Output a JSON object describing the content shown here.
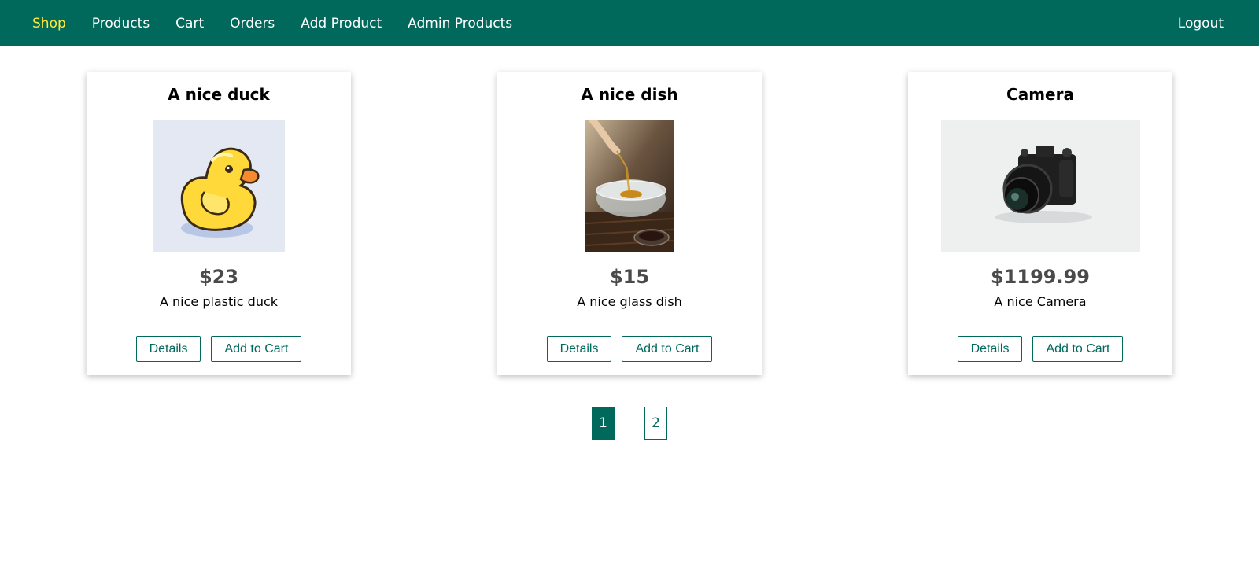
{
  "nav": {
    "items": [
      "Shop",
      "Products",
      "Cart",
      "Orders",
      "Add Product",
      "Admin Products"
    ],
    "active": "Shop",
    "logout": "Logout"
  },
  "products": [
    {
      "title": "A nice duck",
      "price": "$23",
      "description": "A nice plastic duck",
      "details_label": "Details",
      "cart_label": "Add to Cart"
    },
    {
      "title": "A nice dish",
      "price": "$15",
      "description": "A nice glass dish",
      "details_label": "Details",
      "cart_label": "Add to Cart"
    },
    {
      "title": "Camera",
      "price": "$1199.99",
      "description": "A nice Camera",
      "details_label": "Details",
      "cart_label": "Add to Cart"
    }
  ],
  "pagination": {
    "pages": [
      "1",
      "2"
    ],
    "current": "1"
  },
  "colors": {
    "primary": "#00695c",
    "active_nav": "#ffeb3b"
  }
}
